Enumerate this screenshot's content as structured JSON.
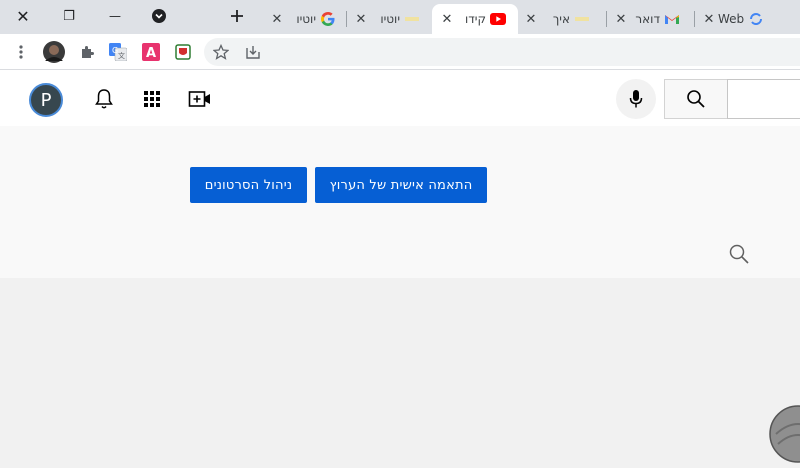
{
  "window_controls": {
    "close": "✕",
    "restore": "❐",
    "minimize": "—"
  },
  "tabs": [
    {
      "title": "Web",
      "favicon": "refresh-favicon",
      "active": false
    },
    {
      "title": "דואר",
      "favicon": "gmail-favicon",
      "active": false
    },
    {
      "title": "איך",
      "favicon": "generic-favicon",
      "active": false
    },
    {
      "title": "קידו",
      "favicon": "youtube-favicon",
      "active": true
    },
    {
      "title": "יוטיו",
      "favicon": "generic-favicon",
      "active": false
    },
    {
      "title": "יוטיו",
      "favicon": "google-favicon",
      "active": false
    }
  ],
  "masthead": {
    "avatar_letter": "P"
  },
  "channel": {
    "customize_button": "התאמה אישית של הערוץ",
    "manage_videos_button": "ניהול הסרטונים"
  },
  "colors": {
    "accent_blue": "#065fd4",
    "youtube_red": "#ff0000"
  }
}
